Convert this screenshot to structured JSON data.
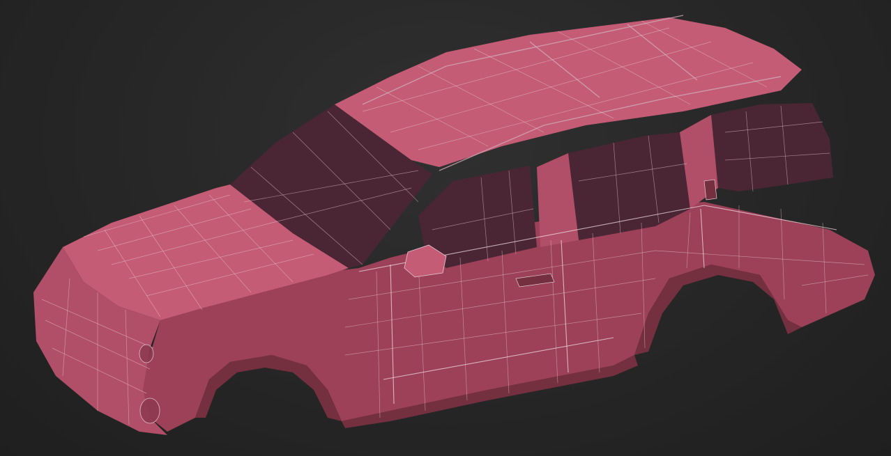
{
  "viewport": {
    "background_color": "#262626",
    "model_color": "#b24f68",
    "wireframe_color": "#e7c9d2",
    "display_mode": "wireframe-on-shaded",
    "subject": "suv-body-shell-mesh"
  }
}
